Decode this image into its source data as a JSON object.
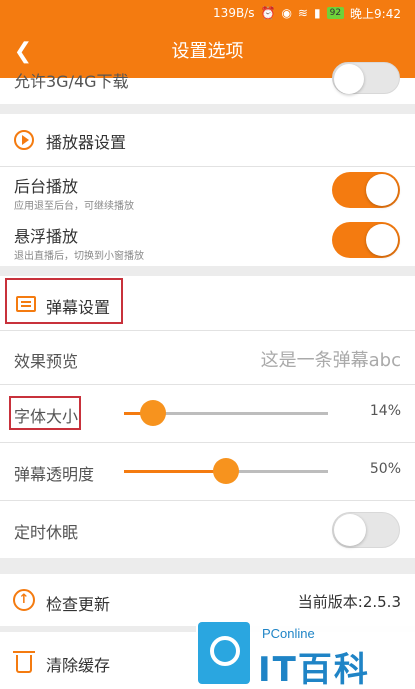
{
  "status_bar": {
    "speed": "139B/s",
    "battery": "92",
    "time": "晚上9:42",
    "icons": [
      "alarm-icon",
      "eye-icon",
      "wifi-icon",
      "signal-icon",
      "battery-icon"
    ]
  },
  "header": {
    "title": "设置选项",
    "back_icon": "chevron-left-icon"
  },
  "network": {
    "partial_label": "允许3G/4G下载",
    "toggle_on": false
  },
  "player_section": {
    "title": "播放器设置",
    "icon": "play-circle-icon",
    "background_play": {
      "label": "后台播放",
      "desc": "应用退至后台，可继续播放",
      "toggle_on": true
    },
    "float_play": {
      "label": "悬浮播放",
      "desc": "退出直播后，切换到小窗播放",
      "toggle_on": true
    }
  },
  "danmu_section": {
    "title": "弹幕设置",
    "icon": "danmu-icon",
    "preview": {
      "label": "效果预览",
      "sample": "这是一条弹幕abc"
    },
    "font_size": {
      "label": "字体大小",
      "value_text": "14%",
      "value": 14
    },
    "opacity": {
      "label": "弹幕透明度",
      "value_text": "50%",
      "value": 50
    },
    "sleep_timer": {
      "label": "定时休眠",
      "toggle_on": false
    }
  },
  "misc_section": {
    "check_update": {
      "label": "检查更新",
      "icon": "arrow-up-circle-icon",
      "version": "当前版本:2.5.3"
    },
    "clear_cache": {
      "label": "清除缓存",
      "icon": "trash-icon"
    }
  },
  "watermark": {
    "brand": "PConline",
    "name": "IT百科"
  },
  "colors": {
    "accent": "#f47b10",
    "highlight_box": "#c8313b",
    "watermark": "#1f84c6"
  }
}
